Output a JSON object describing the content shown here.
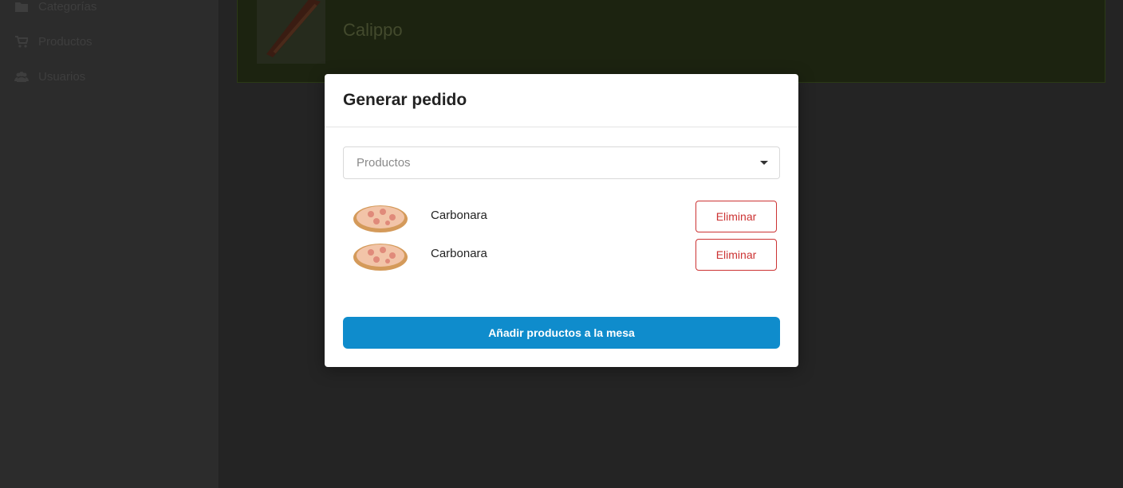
{
  "sidebar": {
    "items": [
      {
        "label": "Categorías",
        "icon": "folder-icon"
      },
      {
        "label": "Productos",
        "icon": "cart-icon"
      },
      {
        "label": "Usuarios",
        "icon": "users-icon"
      }
    ]
  },
  "background_card": {
    "product_name": "Calippo"
  },
  "modal": {
    "title": "Generar pedido",
    "select_placeholder": "Productos",
    "items": [
      {
        "name": "Carbonara",
        "remove_label": "Eliminar"
      },
      {
        "name": "Carbonara",
        "remove_label": "Eliminar"
      }
    ],
    "submit_label": "Añadir productos a la mesa"
  },
  "colors": {
    "primary": "#0f8ccc",
    "danger": "#cc3333",
    "overlay": "#252525"
  }
}
